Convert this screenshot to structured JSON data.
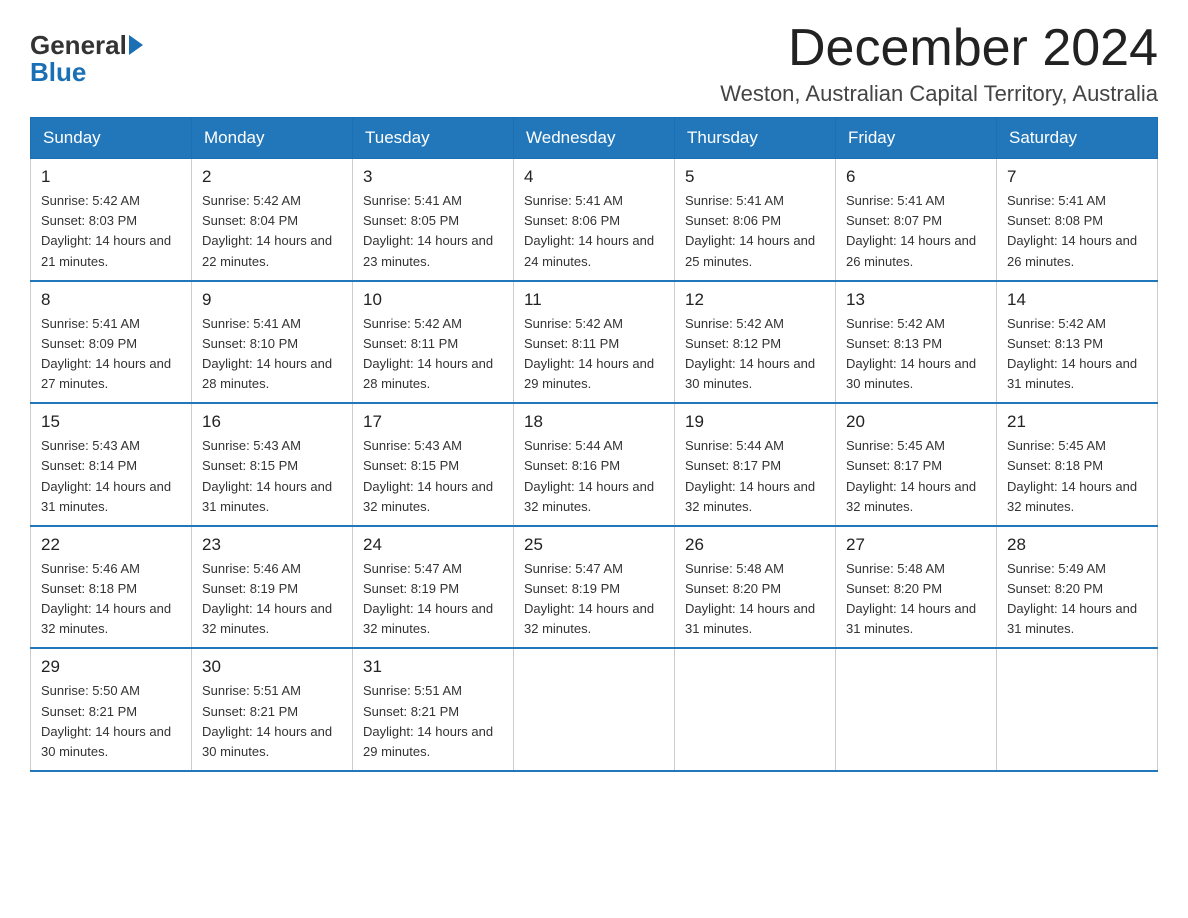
{
  "logo": {
    "text_general": "General",
    "text_blue": "Blue"
  },
  "title": "December 2024",
  "subtitle": "Weston, Australian Capital Territory, Australia",
  "days_of_week": [
    "Sunday",
    "Monday",
    "Tuesday",
    "Wednesday",
    "Thursday",
    "Friday",
    "Saturday"
  ],
  "weeks": [
    [
      {
        "day": "1",
        "sunrise": "5:42 AM",
        "sunset": "8:03 PM",
        "daylight": "14 hours and 21 minutes."
      },
      {
        "day": "2",
        "sunrise": "5:42 AM",
        "sunset": "8:04 PM",
        "daylight": "14 hours and 22 minutes."
      },
      {
        "day": "3",
        "sunrise": "5:41 AM",
        "sunset": "8:05 PM",
        "daylight": "14 hours and 23 minutes."
      },
      {
        "day": "4",
        "sunrise": "5:41 AM",
        "sunset": "8:06 PM",
        "daylight": "14 hours and 24 minutes."
      },
      {
        "day": "5",
        "sunrise": "5:41 AM",
        "sunset": "8:06 PM",
        "daylight": "14 hours and 25 minutes."
      },
      {
        "day": "6",
        "sunrise": "5:41 AM",
        "sunset": "8:07 PM",
        "daylight": "14 hours and 26 minutes."
      },
      {
        "day": "7",
        "sunrise": "5:41 AM",
        "sunset": "8:08 PM",
        "daylight": "14 hours and 26 minutes."
      }
    ],
    [
      {
        "day": "8",
        "sunrise": "5:41 AM",
        "sunset": "8:09 PM",
        "daylight": "14 hours and 27 minutes."
      },
      {
        "day": "9",
        "sunrise": "5:41 AM",
        "sunset": "8:10 PM",
        "daylight": "14 hours and 28 minutes."
      },
      {
        "day": "10",
        "sunrise": "5:42 AM",
        "sunset": "8:11 PM",
        "daylight": "14 hours and 28 minutes."
      },
      {
        "day": "11",
        "sunrise": "5:42 AM",
        "sunset": "8:11 PM",
        "daylight": "14 hours and 29 minutes."
      },
      {
        "day": "12",
        "sunrise": "5:42 AM",
        "sunset": "8:12 PM",
        "daylight": "14 hours and 30 minutes."
      },
      {
        "day": "13",
        "sunrise": "5:42 AM",
        "sunset": "8:13 PM",
        "daylight": "14 hours and 30 minutes."
      },
      {
        "day": "14",
        "sunrise": "5:42 AM",
        "sunset": "8:13 PM",
        "daylight": "14 hours and 31 minutes."
      }
    ],
    [
      {
        "day": "15",
        "sunrise": "5:43 AM",
        "sunset": "8:14 PM",
        "daylight": "14 hours and 31 minutes."
      },
      {
        "day": "16",
        "sunrise": "5:43 AM",
        "sunset": "8:15 PM",
        "daylight": "14 hours and 31 minutes."
      },
      {
        "day": "17",
        "sunrise": "5:43 AM",
        "sunset": "8:15 PM",
        "daylight": "14 hours and 32 minutes."
      },
      {
        "day": "18",
        "sunrise": "5:44 AM",
        "sunset": "8:16 PM",
        "daylight": "14 hours and 32 minutes."
      },
      {
        "day": "19",
        "sunrise": "5:44 AM",
        "sunset": "8:17 PM",
        "daylight": "14 hours and 32 minutes."
      },
      {
        "day": "20",
        "sunrise": "5:45 AM",
        "sunset": "8:17 PM",
        "daylight": "14 hours and 32 minutes."
      },
      {
        "day": "21",
        "sunrise": "5:45 AM",
        "sunset": "8:18 PM",
        "daylight": "14 hours and 32 minutes."
      }
    ],
    [
      {
        "day": "22",
        "sunrise": "5:46 AM",
        "sunset": "8:18 PM",
        "daylight": "14 hours and 32 minutes."
      },
      {
        "day": "23",
        "sunrise": "5:46 AM",
        "sunset": "8:19 PM",
        "daylight": "14 hours and 32 minutes."
      },
      {
        "day": "24",
        "sunrise": "5:47 AM",
        "sunset": "8:19 PM",
        "daylight": "14 hours and 32 minutes."
      },
      {
        "day": "25",
        "sunrise": "5:47 AM",
        "sunset": "8:19 PM",
        "daylight": "14 hours and 32 minutes."
      },
      {
        "day": "26",
        "sunrise": "5:48 AM",
        "sunset": "8:20 PM",
        "daylight": "14 hours and 31 minutes."
      },
      {
        "day": "27",
        "sunrise": "5:48 AM",
        "sunset": "8:20 PM",
        "daylight": "14 hours and 31 minutes."
      },
      {
        "day": "28",
        "sunrise": "5:49 AM",
        "sunset": "8:20 PM",
        "daylight": "14 hours and 31 minutes."
      }
    ],
    [
      {
        "day": "29",
        "sunrise": "5:50 AM",
        "sunset": "8:21 PM",
        "daylight": "14 hours and 30 minutes."
      },
      {
        "day": "30",
        "sunrise": "5:51 AM",
        "sunset": "8:21 PM",
        "daylight": "14 hours and 30 minutes."
      },
      {
        "day": "31",
        "sunrise": "5:51 AM",
        "sunset": "8:21 PM",
        "daylight": "14 hours and 29 minutes."
      },
      null,
      null,
      null,
      null
    ]
  ],
  "labels": {
    "sunrise": "Sunrise:",
    "sunset": "Sunset:",
    "daylight": "Daylight:"
  }
}
